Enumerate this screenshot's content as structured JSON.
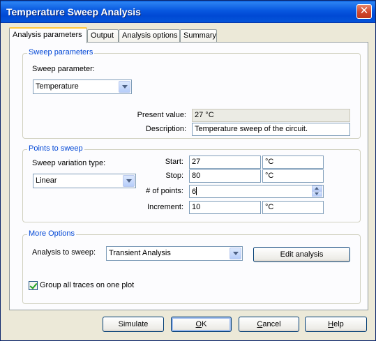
{
  "window": {
    "title": "Temperature Sweep Analysis",
    "close_glyph": "✕"
  },
  "tabs": [
    {
      "label": "Analysis parameters",
      "active": true
    },
    {
      "label": "Output"
    },
    {
      "label": "Analysis options"
    },
    {
      "label": "Summary"
    }
  ],
  "sweep": {
    "legend": "Sweep parameters",
    "param_label": "Sweep parameter:",
    "param_value": "Temperature",
    "present_label": "Present value:",
    "present_value": "27 °C",
    "desc_label": "Description:",
    "desc_value": "Temperature sweep of the circuit."
  },
  "points": {
    "legend": "Points to sweep",
    "variation_label": "Sweep variation type:",
    "variation_value": "Linear",
    "start_label": "Start:",
    "start_value": "27",
    "start_unit": "°C",
    "stop_label": "Stop:",
    "stop_value": "80",
    "stop_unit": "°C",
    "npoints_label": "# of points:",
    "npoints_value": "6",
    "increment_label": "Increment:",
    "increment_value": "10",
    "increment_unit": "°C"
  },
  "more": {
    "legend": "More Options",
    "analysis_label": "Analysis to sweep:",
    "analysis_value": "Transient Analysis",
    "edit_button": "Edit analysis",
    "group_traces_label": "Group all traces on one plot",
    "group_traces_checked": true
  },
  "buttons": {
    "simulate": "Simulate",
    "ok_mnemonic": "O",
    "ok_rest": "K",
    "cancel_mnemonic": "C",
    "cancel_rest": "ancel",
    "help_mnemonic": "H",
    "help_rest": "elp"
  },
  "colors": {
    "title_bar": "#0858e0",
    "group_legend": "#0046d5",
    "close_button": "#d1472d"
  }
}
